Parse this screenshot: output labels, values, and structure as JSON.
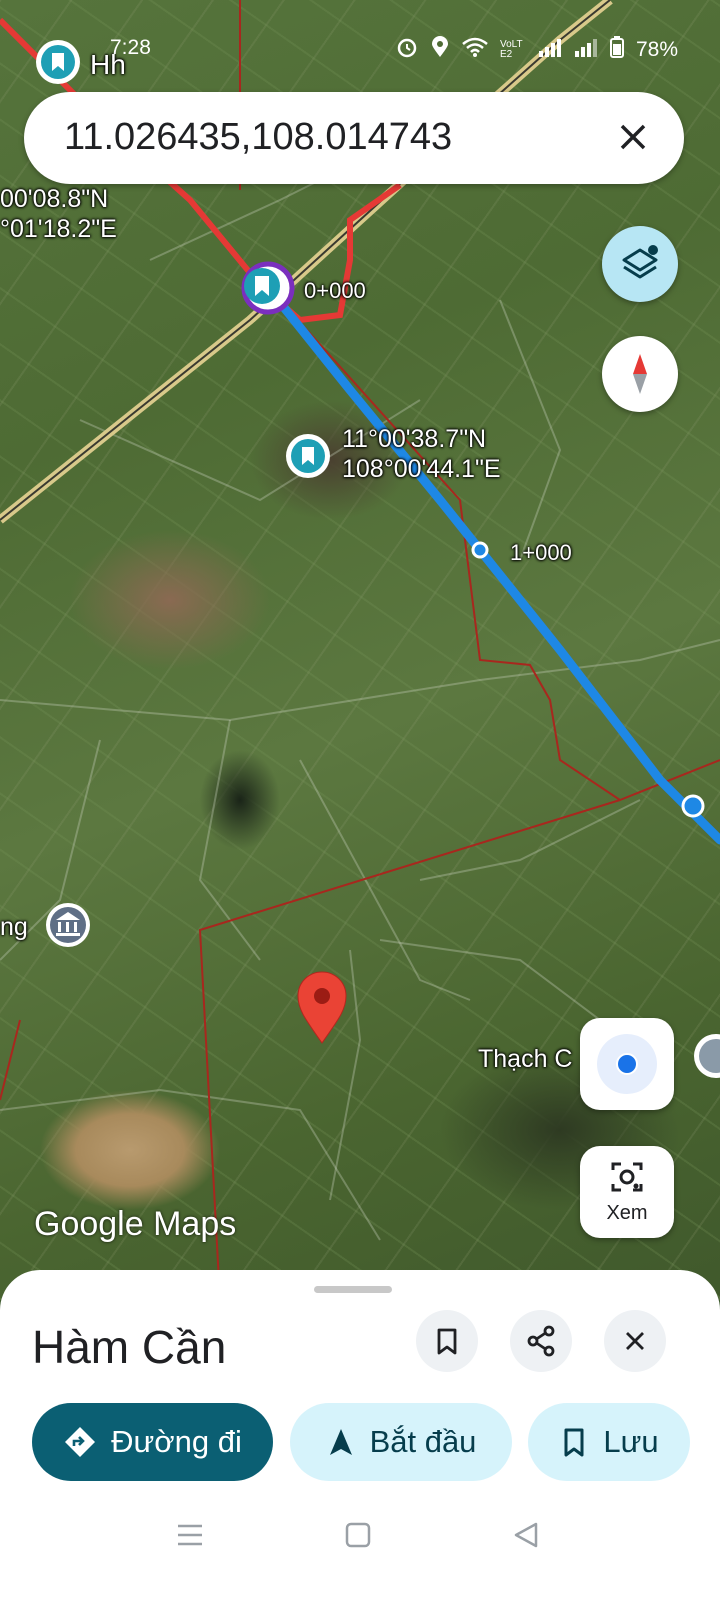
{
  "status_bar": {
    "time": "7:28",
    "volte": "VoLTE2",
    "battery": "78%"
  },
  "search": {
    "query": "11.026435,108.014743"
  },
  "map": {
    "labels": {
      "top_left_pin": "Hh",
      "coord_left": "00'08.8\"N\n°01'18.2\"E",
      "km_zero": "0+000",
      "coord_center": "11°00'38.7\"N\n108°00'44.1\"E",
      "km_one": "1+000",
      "left_place": "ng",
      "place_right": "Thạch C"
    },
    "watermark": "Google Maps"
  },
  "buttons": {
    "xem": "Xem"
  },
  "sheet": {
    "title": "Hàm Cần",
    "directions": "Đường đi",
    "start": "Bắt đầu",
    "save": "Lưu"
  },
  "colors": {
    "primary": "#0b5f73",
    "secondary": "#d6f3fb",
    "route_blue": "#1e88e5",
    "route_red": "#e53935",
    "pin_red": "#ea4335"
  }
}
